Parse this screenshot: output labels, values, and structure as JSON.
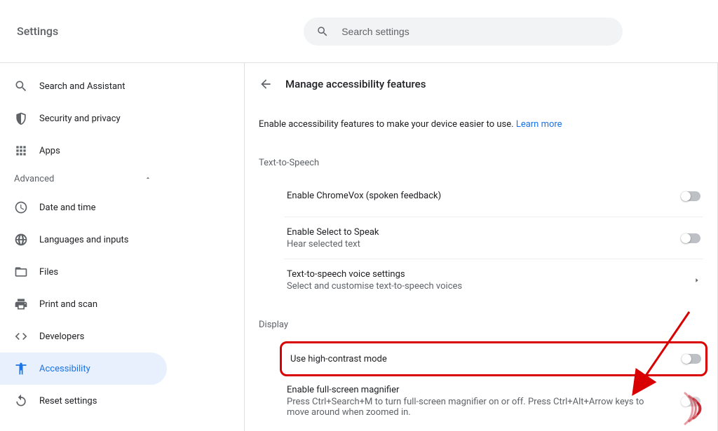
{
  "app_title": "Settings",
  "search": {
    "placeholder": "Search settings"
  },
  "sidebar": {
    "items": [
      {
        "label": "Search and Assistant"
      },
      {
        "label": "Security and privacy"
      },
      {
        "label": "Apps"
      }
    ],
    "advanced_label": "Advanced",
    "advanced_items": [
      {
        "label": "Date and time"
      },
      {
        "label": "Languages and inputs"
      },
      {
        "label": "Files"
      },
      {
        "label": "Print and scan"
      },
      {
        "label": "Developers"
      },
      {
        "label": "Accessibility"
      },
      {
        "label": "Reset settings"
      }
    ]
  },
  "page": {
    "title": "Manage accessibility features",
    "intro_text": "Enable accessibility features to make your device easier to use. ",
    "intro_link": "Learn more",
    "sections": [
      {
        "label": "Text-to-Speech",
        "rows": [
          {
            "title": "Enable ChromeVox (spoken feedback)",
            "subtitle": "",
            "type": "toggle",
            "value": false
          },
          {
            "title": "Enable Select to Speak",
            "subtitle": "Hear selected text",
            "type": "toggle",
            "value": false
          },
          {
            "title": "Text-to-speech voice settings",
            "subtitle": "Select and customise text-to-speech voices",
            "type": "link"
          }
        ]
      },
      {
        "label": "Display",
        "rows": [
          {
            "title": "Use high-contrast mode",
            "subtitle": "",
            "type": "toggle",
            "value": false,
            "highlighted": true
          },
          {
            "title": "Enable full-screen magnifier",
            "subtitle": "Press Ctrl+Search+M to turn full-screen magnifier on or off. Press Ctrl+Alt+Arrow keys to move around when zoomed in.",
            "type": "toggle",
            "value": false
          }
        ]
      }
    ]
  }
}
